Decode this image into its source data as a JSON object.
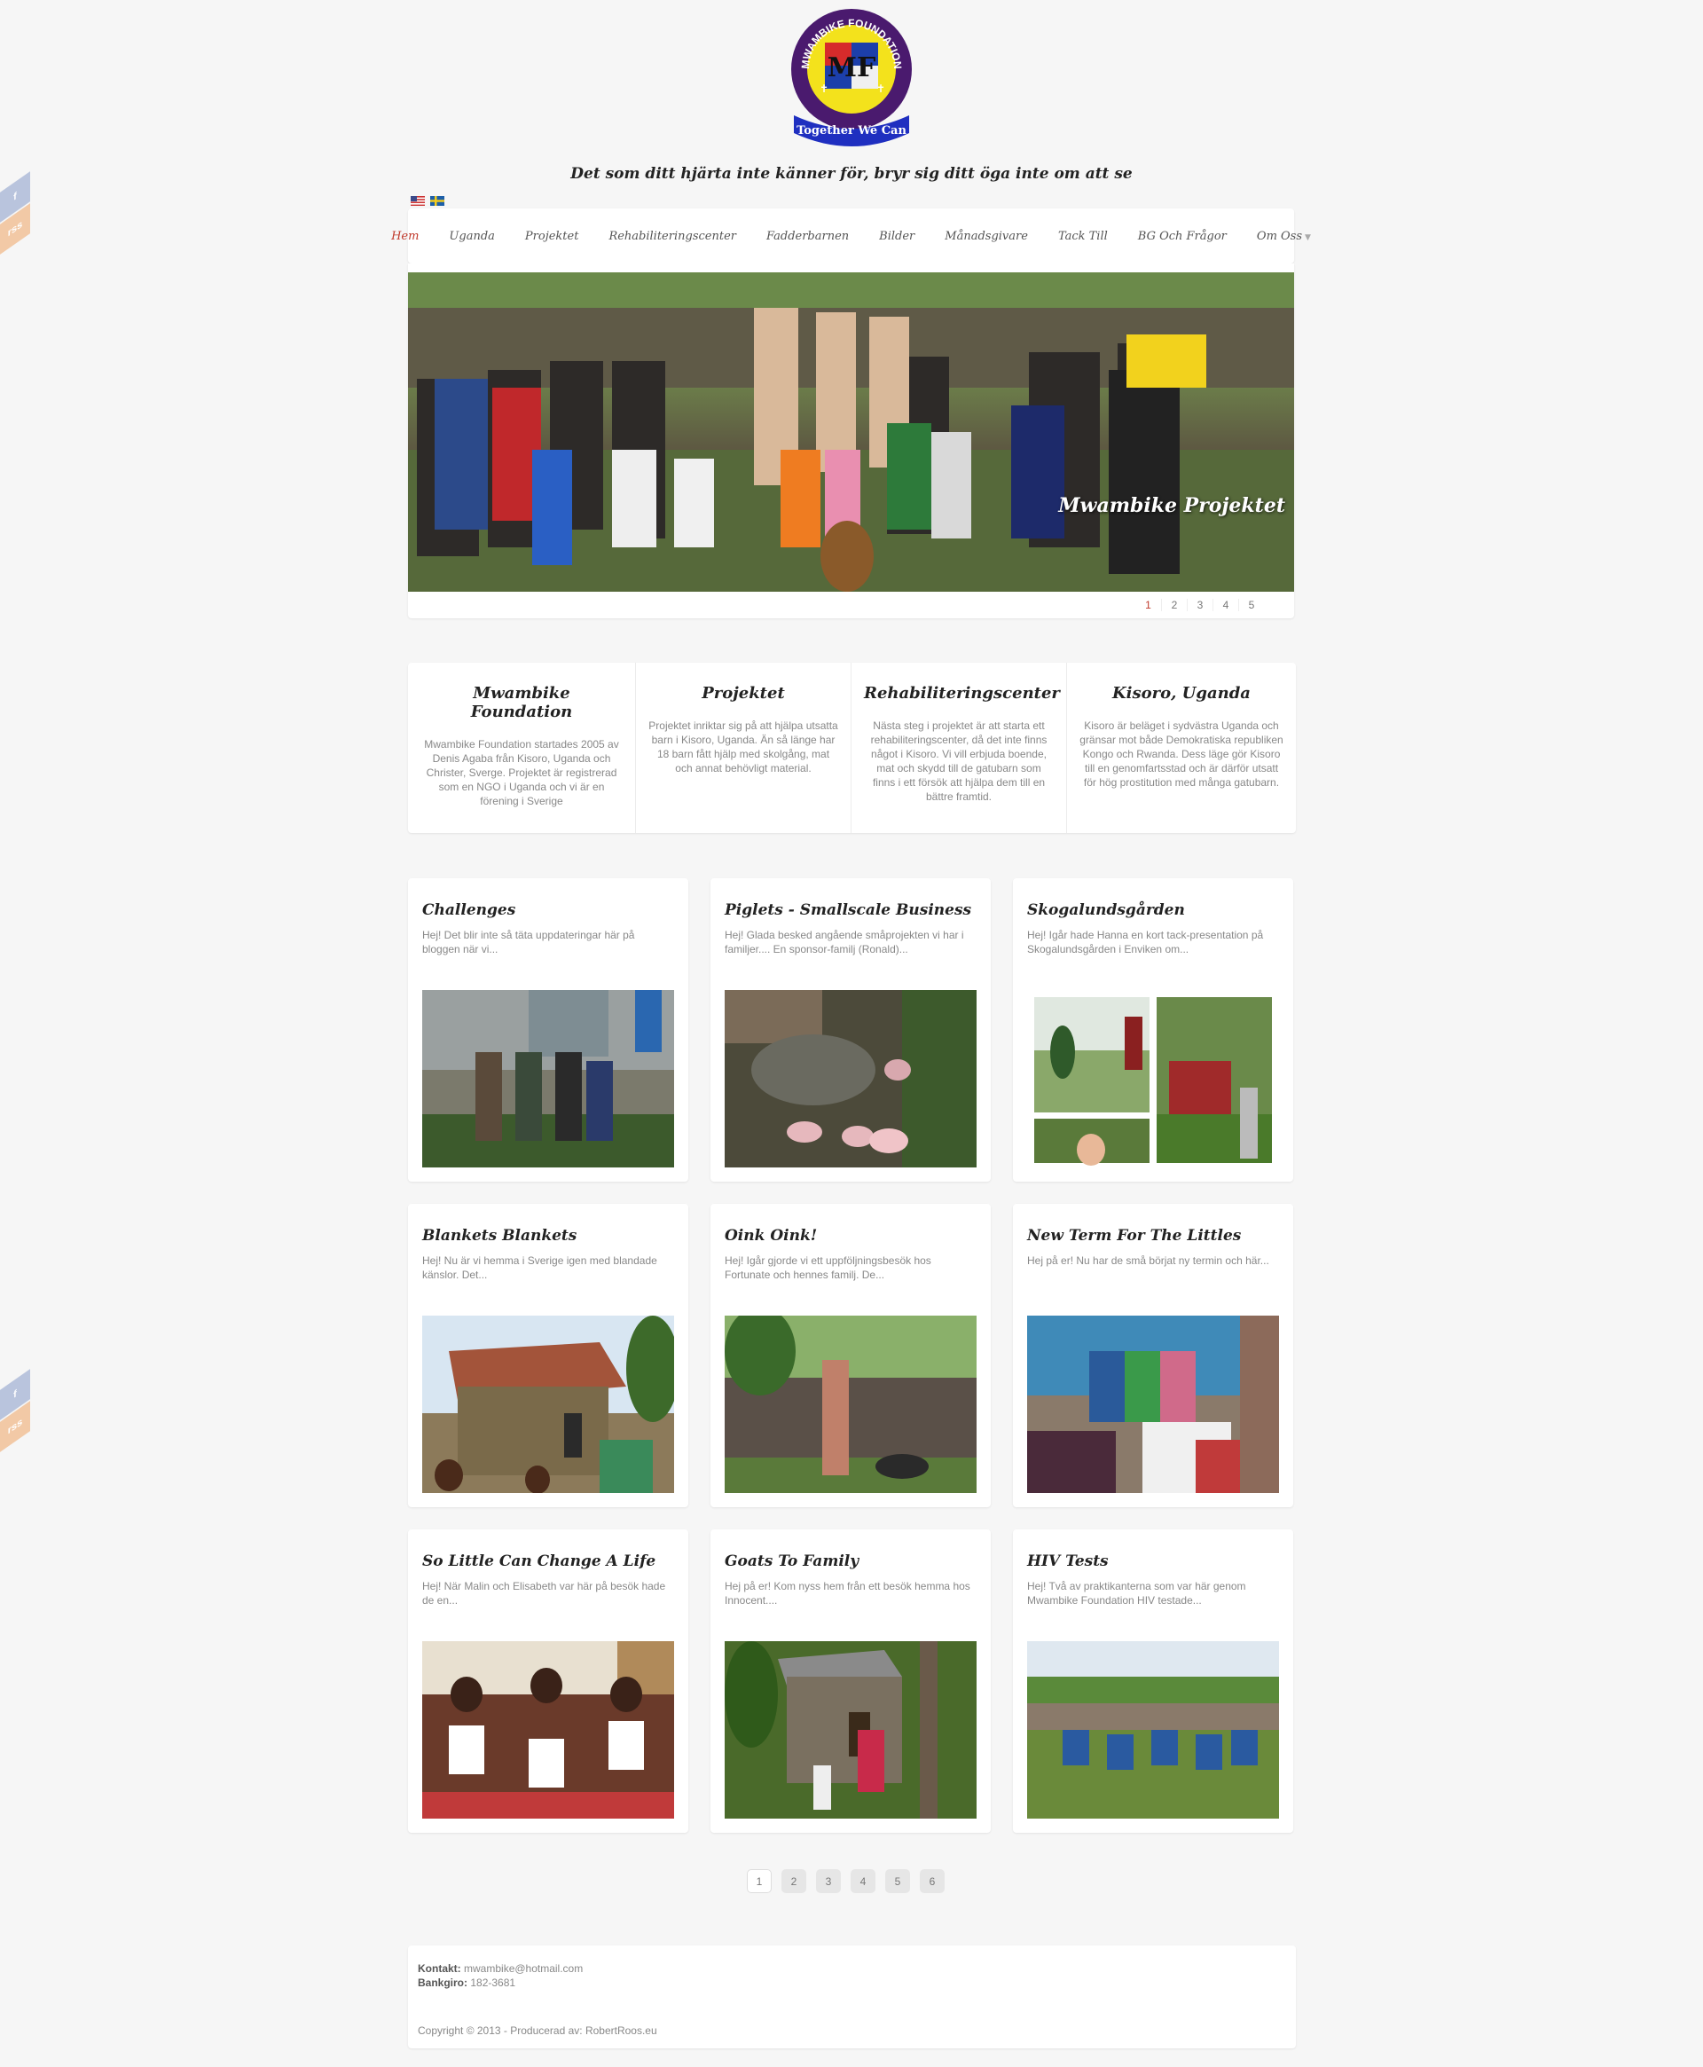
{
  "header": {
    "logo_text": "MWAMBIKE FOUNDATION",
    "logo_banner": "Together We Can",
    "tagline": "Det som ditt hjärta inte känner för, bryr sig ditt öga inte om att se"
  },
  "nav": {
    "items": [
      {
        "label": "Hem"
      },
      {
        "label": "Uganda"
      },
      {
        "label": "Projektet"
      },
      {
        "label": "Rehabiliteringscenter"
      },
      {
        "label": "Fadderbarnen"
      },
      {
        "label": "Bilder"
      },
      {
        "label": "Månadsgivare"
      },
      {
        "label": "Tack Till"
      },
      {
        "label": "BG Och Frågor"
      },
      {
        "label": "Om Oss"
      }
    ]
  },
  "slider": {
    "caption": "Mwambike Projektet",
    "pages": [
      "1",
      "2",
      "3",
      "4",
      "5"
    ]
  },
  "features": [
    {
      "title": "Mwambike Foundation",
      "text": "Mwambike Foundation startades 2005 av Denis Agaba från Kisoro, Uganda och Christer, Sverge. Projektet är registrerad som en NGO i Uganda och vi är en förening i Sverige"
    },
    {
      "title": "Projektet",
      "text": "Projektet inriktar sig på att hjälpa utsatta barn i Kisoro, Uganda. Än så länge har 18 barn fått hjälp med skolgång, mat och annat behövligt material."
    },
    {
      "title": "Rehabiliteringscenter",
      "text": "Nästa steg i projektet är att starta ett rehabiliteringscenter, då det inte finns något i Kisoro. Vi vill erbjuda boende, mat och skydd till de gatubarn som finns i ett försök att hjälpa dem till en bättre framtid."
    },
    {
      "title": "Kisoro, Uganda",
      "text": "Kisoro är beläget i sydvästra Uganda och gränsar mot både Demokratiska republiken Kongo och Rwanda. Dess läge gör Kisoro till en genomfartsstad och är därför utsatt för hög prostitution med många gatubarn."
    }
  ],
  "posts": [
    {
      "title": "Challenges",
      "excerpt": "Hej! Det blir inte så täta uppdateringar här på bloggen när vi..."
    },
    {
      "title": "Piglets - Smallscale Business",
      "excerpt": "Hej! Glada besked angående småprojekten vi har i familjer.... En sponsor-familj (Ronald)..."
    },
    {
      "title": "Skogalundsgården",
      "excerpt": "Hej! Igår hade Hanna en kort tack-presentation på Skogalundsgården i Enviken om..."
    },
    {
      "title": "Blankets Blankets",
      "excerpt": "Hej! Nu är vi hemma i Sverige igen med blandade känslor. Det..."
    },
    {
      "title": "Oink Oink!",
      "excerpt": "Hej! Igår gjorde vi ett uppföljningsbesök hos Fortunate och hennes familj. De..."
    },
    {
      "title": "New Term For The Littles",
      "excerpt": "Hej på er! Nu har de små börjat ny termin och här..."
    },
    {
      "title": "So Little Can Change A Life",
      "excerpt": "Hej! När Malin och Elisabeth var här på besök hade de en..."
    },
    {
      "title": "Goats To Family",
      "excerpt": "Hej på er! Kom nyss hem från ett besök hemma hos Innocent...."
    },
    {
      "title": "HIV Tests",
      "excerpt": "Hej! Två av praktikanterna som var här genom Mwambike Foundation HIV testade..."
    }
  ],
  "pagination": [
    "1",
    "2",
    "3",
    "4",
    "5",
    "6"
  ],
  "footer": {
    "contact_label": "Kontakt:",
    "contact_value": "mwambike@hotmail.com",
    "bankgiro_label": "Bankgiro:",
    "bankgiro_value": "182-3681",
    "copyright": "Copyright © 2013 - Producerad av: RobertRoos.eu"
  },
  "social": {
    "fb": "f",
    "rss": "rss"
  },
  "colors": {
    "accent": "#c0392b",
    "background": "#f6f6f6"
  }
}
